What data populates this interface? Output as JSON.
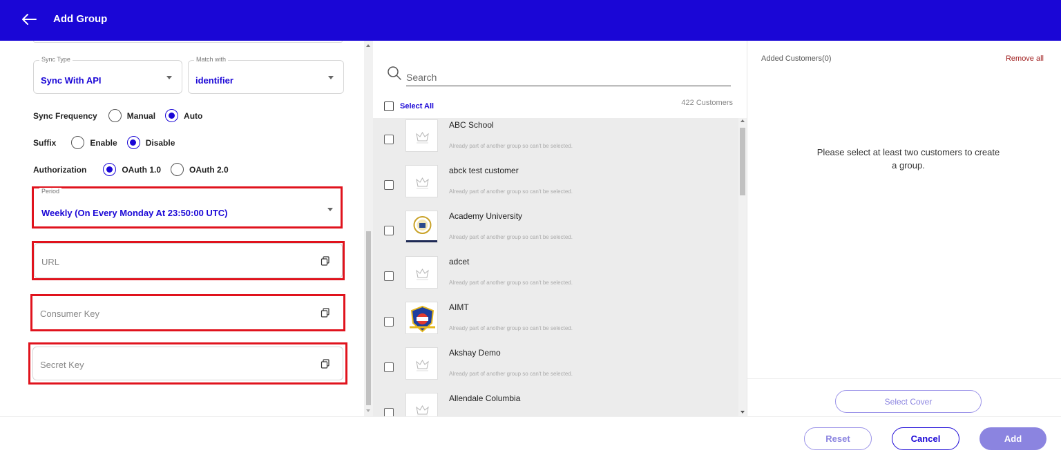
{
  "header": {
    "title": "Add Group",
    "back_icon": "arrow-left-icon",
    "bg_color": "#1a06d6"
  },
  "form": {
    "sync_type": {
      "legend": "Sync Type",
      "value": "Sync With API"
    },
    "match_with": {
      "legend": "Match with",
      "value": "identifier"
    },
    "sync_frequency": {
      "label": "Sync Frequency",
      "options": [
        "Manual",
        "Auto"
      ],
      "selected": "Auto"
    },
    "suffix": {
      "label": "Suffix",
      "options": [
        "Enable",
        "Disable"
      ],
      "selected": "Disable"
    },
    "authorization": {
      "label": "Authorization",
      "options": [
        "OAuth 1.0",
        "OAuth 2.0"
      ],
      "selected": "OAuth 1.0"
    },
    "period": {
      "legend": "Period",
      "value": "Weekly (On Every Monday At 23:50:00 UTC)"
    },
    "url": {
      "placeholder": "URL"
    },
    "consumer_key": {
      "placeholder": "Consumer Key"
    },
    "secret_key": {
      "placeholder": "Secret Key"
    },
    "highlight_color": "#e0131d"
  },
  "customers": {
    "search_placeholder": "Search",
    "select_all_label": "Select All",
    "count_label": "422 Customers",
    "items": [
      {
        "name": "ABC School",
        "note": "Already part of another group so can't be selected.",
        "logo": "crown-placeholder"
      },
      {
        "name": "abck test customer",
        "note": "Already part of another group so can't be selected.",
        "logo": "crown-placeholder"
      },
      {
        "name": "Academy University",
        "note": "Already part of another group so can't be selected.",
        "logo": "academy-emblem"
      },
      {
        "name": "adcet",
        "note": "Already part of another group so can't be selected.",
        "logo": "crown-placeholder"
      },
      {
        "name": "AIMT",
        "note": "Already part of another group so can't be selected.",
        "logo": "aimt-shield"
      },
      {
        "name": "Akshay Demo",
        "note": "Already part of another group so can't be selected.",
        "logo": "crown-placeholder"
      },
      {
        "name": "Allendale Columbia",
        "note": "",
        "logo": "crown-placeholder"
      }
    ]
  },
  "added": {
    "title": "Added Customers(0)",
    "remove_all": "Remove all",
    "empty_message": "Please select at least two customers to create a group.",
    "select_cover": "Select Cover"
  },
  "footer": {
    "reset": "Reset",
    "cancel": "Cancel",
    "add": "Add"
  }
}
